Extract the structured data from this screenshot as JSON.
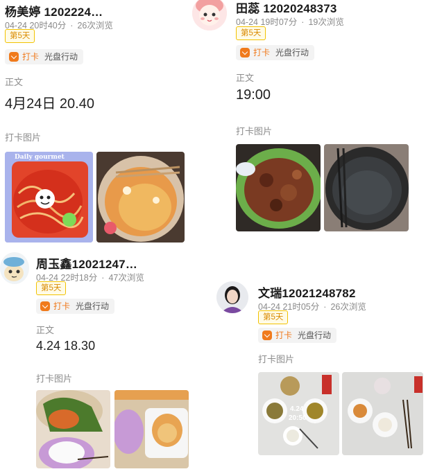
{
  "posts": [
    {
      "name": "杨美婷 1202224…",
      "date": "04-24 20时40分",
      "views": "26次浏览",
      "days": "第5天",
      "tag_checkin": "打卡",
      "tag_topic": "光盘行动",
      "body_label": "正文",
      "body_text": "4月24日 20.40",
      "photos_label": "打卡图片",
      "photo_overlay": "Daily gourmet",
      "photo_count": 2
    },
    {
      "name": "田蕊 12020248373",
      "date": "04-24 19时07分",
      "views": "19次浏览",
      "days": "第5天",
      "tag_checkin": "打卡",
      "tag_topic": "光盘行动",
      "body_label": "正文",
      "body_text": "19:00",
      "photos_label": "打卡图片",
      "photo_count": 2
    },
    {
      "name": "周玉鑫12021247…",
      "date": "04-24 22时18分",
      "views": "47次浏览",
      "days": "第5天",
      "tag_checkin": "打卡",
      "tag_topic": "光盘行动",
      "body_label": "正文",
      "body_text": "4.24 18.30",
      "photos_label": "打卡图片",
      "photo_count": 2
    },
    {
      "name": "文瑞12021248782",
      "date": "04-24 21时05分",
      "views": "26次浏览",
      "days": "第5天",
      "tag_checkin": "打卡",
      "tag_topic": "光盘行动",
      "body_label": "正文",
      "body_text": "",
      "photos_label": "打卡图片",
      "photo_stamp_date": "4.24",
      "photo_stamp_time": "20:50",
      "photo_count": 2
    }
  ],
  "colors": {
    "accent_orange": "#f07a1c",
    "badge_yellow": "#f2c200",
    "meta_gray": "#8a8a8a"
  }
}
